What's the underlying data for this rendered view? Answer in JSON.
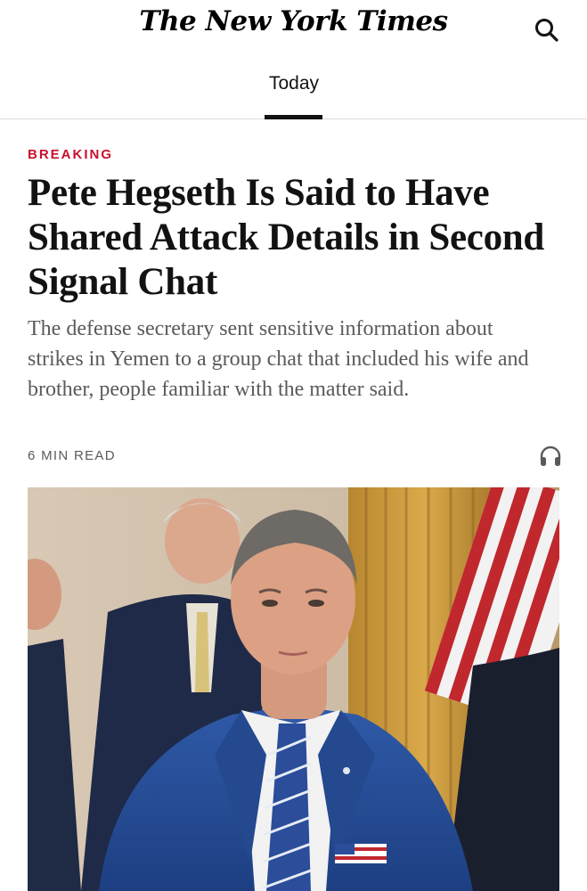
{
  "header": {
    "logo_text": "The New York Times",
    "search_icon": "search-icon"
  },
  "nav": {
    "tabs": [
      {
        "label": "Today",
        "selected": true
      }
    ]
  },
  "article": {
    "kicker": "BREAKING",
    "headline": "Pete Hegseth Is Said to Have Shared Attack Details in Second Signal Chat",
    "summary": "The defense secretary sent sensitive information about strikes in Yemen to a group chat that included his wife and brother, people familiar with the matter said.",
    "read_time": "6 MIN READ",
    "listen_icon": "headphones-icon"
  },
  "colors": {
    "kicker": "#c8102e",
    "text": "#121212",
    "muted": "#5a5a5a",
    "divider": "#dcdcdc"
  }
}
